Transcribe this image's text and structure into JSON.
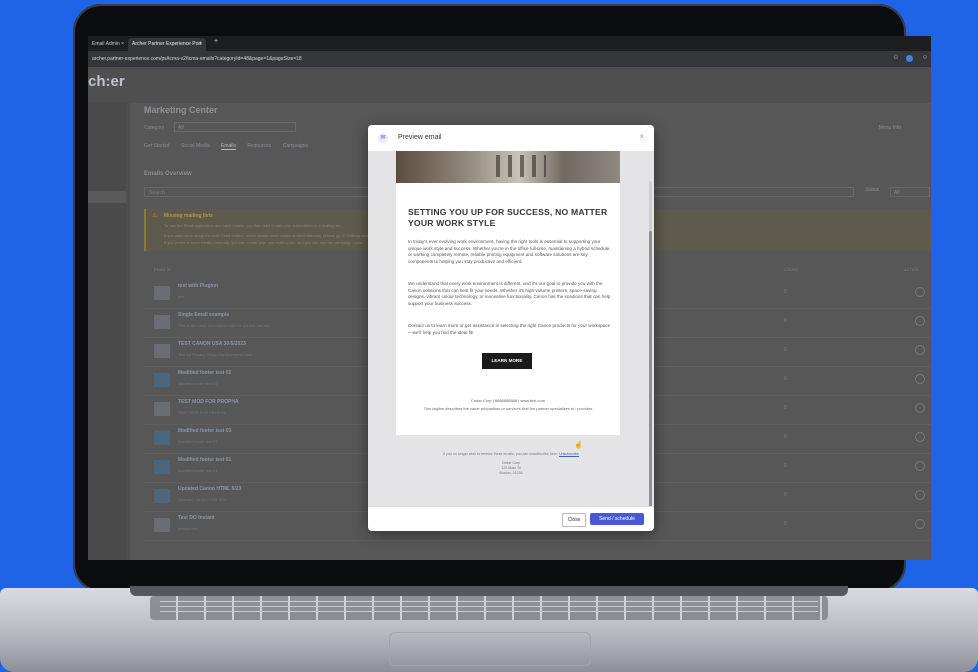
{
  "browser": {
    "tab1": "Email Admin",
    "tab2": "Archer Partner Experience Port",
    "url": "archer.partner-experience.com/ps/tcma-v2/tcma-emails?categoryId=48&page=1&pageSize=18"
  },
  "app": {
    "logo": "ch:er",
    "title": "Marketing Center",
    "category_label": "Category",
    "category_value": "All",
    "menu_info": "Menu Info",
    "tabs": [
      "Get Started",
      "Social Media",
      "Emails",
      "Resources",
      "Campaigns"
    ],
    "overview_title": "Emails Overview",
    "search_placeholder": "Search",
    "status_label": "Status",
    "status_value": "All",
    "alert_title": "Missing mailing lists",
    "alert_line1": "To use the Email application and send emails, you first need to add your subscribers to a mailing list.",
    "alert_line2": "If you want us to setup the Auto Send feature, which allows send emails at fixed intervals, please go to Settings and enable the Auto Send feature in Settings.",
    "alert_line3": "If you prefer to send emails manually, you can create your own mailing list, and you can use the campaign option.",
    "col_email": "EMAIL ID",
    "col_count": "COUNT",
    "col_action": "ACTION",
    "rows": [
      {
        "name": "test with Pluginn",
        "sub": "test",
        "count": "0"
      },
      {
        "name": "Single Email example",
        "sub": "This is the email description that the partner can see",
        "count": "0"
      },
      {
        "name": "TEST CANON USA 30/5/2023",
        "sub": "Test for Privacy Policy Replacement Code",
        "count": "0"
      },
      {
        "name": "Modified footer test 02",
        "sub": "Modified footer test 02",
        "count": "0"
      },
      {
        "name": "TEST MOD FOR PROPHA",
        "sub": "TEST MOD FOR PROPHA",
        "count": "0"
      },
      {
        "name": "Modified footer test 03",
        "sub": "Modified footer test 03",
        "count": "0"
      },
      {
        "name": "Modified footer test 01",
        "sub": "Modified footer test 01",
        "count": "0"
      },
      {
        "name": "Updated Canon HTML 5/23",
        "sub": "Updated Canon HTML 5/23",
        "count": "0"
      },
      {
        "name": "Test DO Instant",
        "sub": "Instant test",
        "count": "0"
      }
    ]
  },
  "modal": {
    "title": "Preview email",
    "close_icon": "×",
    "headline": "SETTING YOU UP FOR SUCCESS, NO MATTER YOUR WORK STYLE",
    "para1": "In today's ever evolving work environment, having the right tools is essential to supporting your unique work style and success. Whether you're in the office full-time, maintaining a hybrid schedule, or working completely remote, reliable printing equipment and software solutions are key components to helping you stay productive and efficient.",
    "para2": "We understand that every work environment is different, and it's our goal to provide you with the Canon solutions that can best fit your needs. Whether it's high-volume printers, space-saving designs, vibrant colour technology, or innovative functionality, Canon has the solutions that can help support your business success.",
    "para3": "Contact us to learn more or get assistance in selecting the right Canon products for your workspace—we'll help you find the ideal fit!",
    "cta": "LEARN MORE",
    "footer_contact": "Cedar Corp | 8888888888 | www.test.com",
    "footer_tagline": "This tagline describes the value proposition or services that the partner specializes in / provides",
    "unsubscribe_text": "If you no longer wish to receive these emails, you can unsubscribe here:",
    "unsubscribe_link": "Unsubscribe",
    "addr1": "Cedar Corp",
    "addr2": "123 Main St",
    "addr3": "Boston, 01234",
    "btn_close": "Close",
    "btn_send": "Send / schedule"
  }
}
